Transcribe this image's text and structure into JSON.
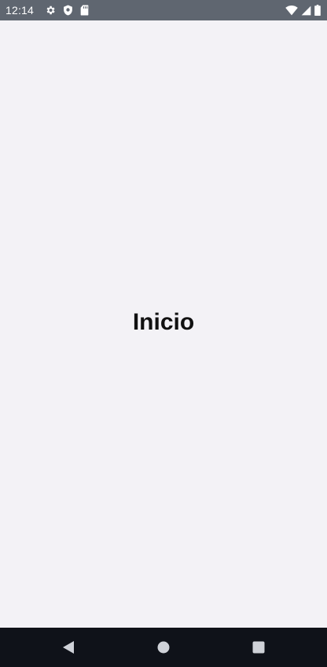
{
  "status_bar": {
    "time": "12:14",
    "left_icons": [
      "gear-icon",
      "shield-icon",
      "sd-card-icon"
    ],
    "right_icons": [
      "wifi-icon",
      "cell-signal-icon",
      "battery-icon"
    ]
  },
  "main": {
    "title": "Inicio"
  },
  "nav_bar": {
    "buttons": [
      "back-icon",
      "home-icon",
      "recents-icon"
    ]
  },
  "colors": {
    "status_bar_bg": "#5f6670",
    "background": "#f3f2f6",
    "nav_bar_bg": "#0f1219",
    "nav_icon": "#cfd2d8",
    "title_text": "#111111"
  }
}
